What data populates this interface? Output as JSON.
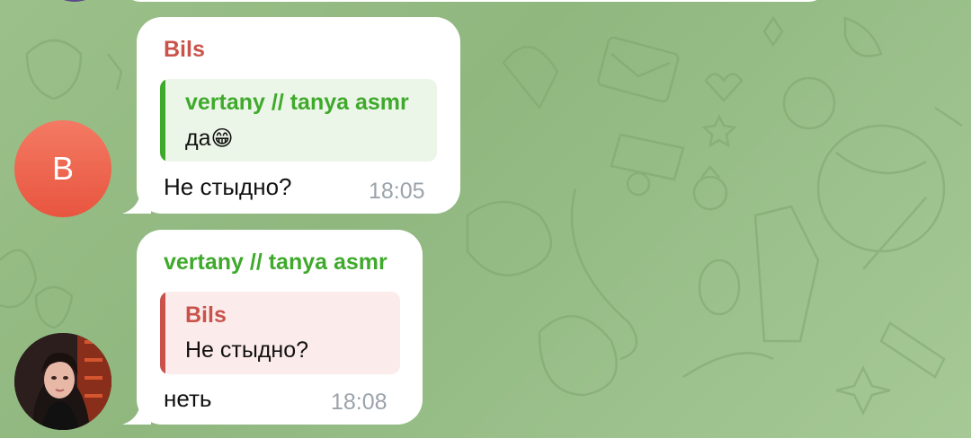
{
  "colors": {
    "bils_accent": "#c9534b",
    "vertany_accent": "#3fa92c",
    "reply_green_bg": "#ecf6e8",
    "reply_red_bg": "#fbeceb",
    "time_gray": "#9aa3ab"
  },
  "messages": [
    {
      "sender": "Bils",
      "avatar_letter": "B",
      "reply_to": {
        "name": "vertany // tanya asmr",
        "text": "да"
      },
      "reply_emoji": "😁",
      "text": "Не стыдно?",
      "time": "18:05"
    },
    {
      "sender": "vertany // tanya asmr",
      "avatar_icon": "user-photo",
      "reply_to": {
        "name": "Bils",
        "text": "Не стыдно?"
      },
      "text": "неть",
      "time": "18:08"
    }
  ]
}
